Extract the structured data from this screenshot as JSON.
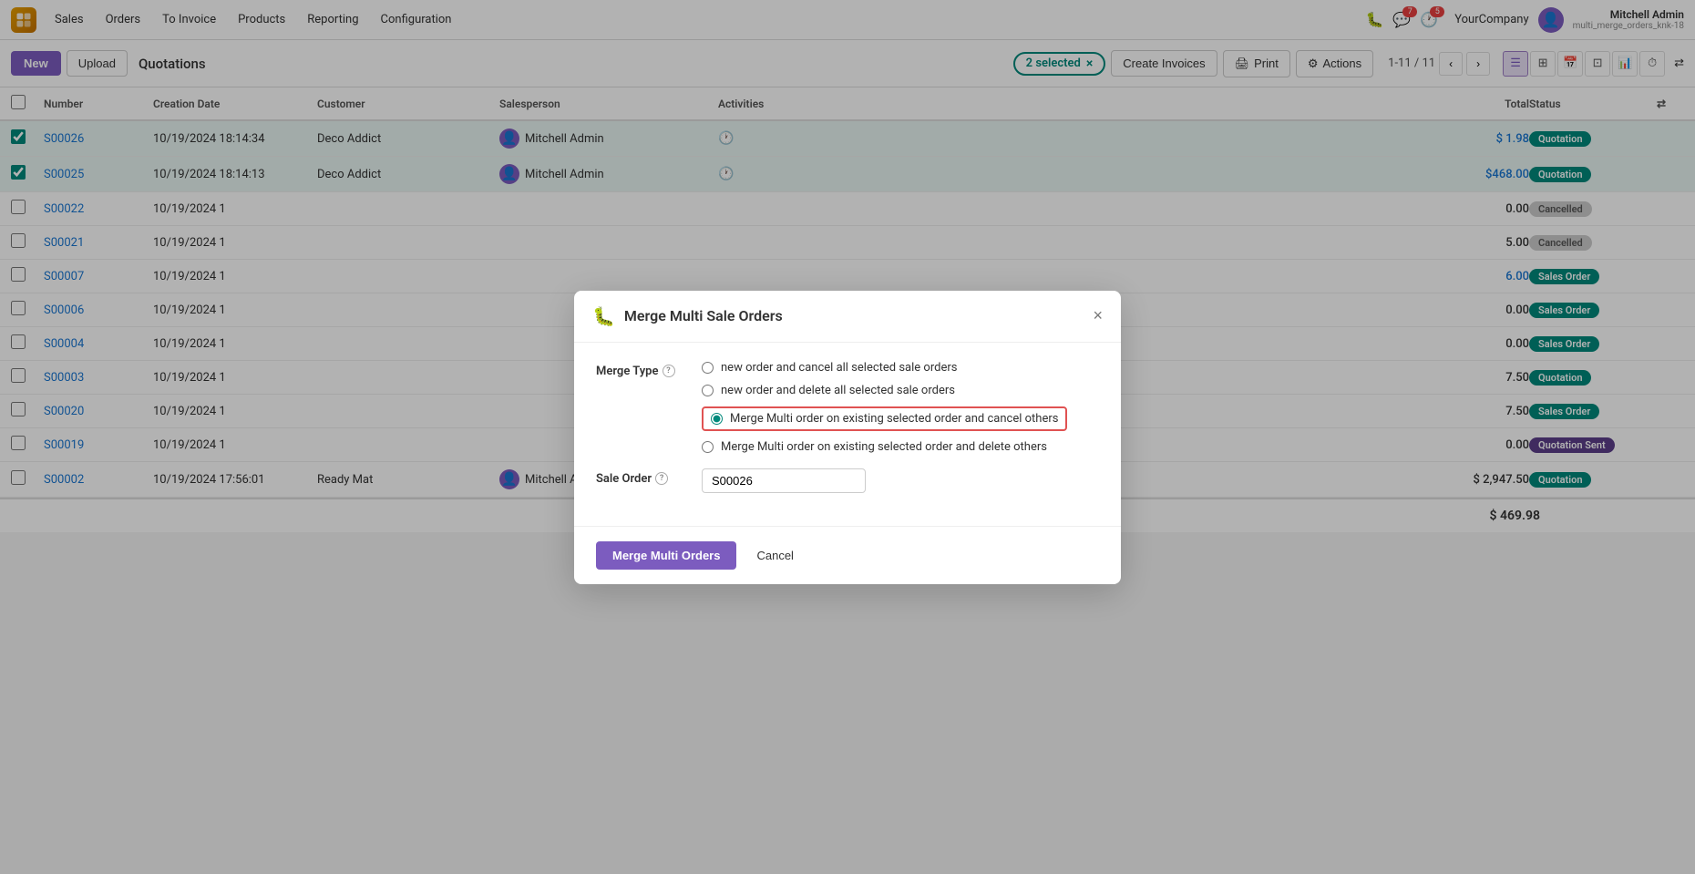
{
  "app": {
    "logo_text": "S",
    "module": "Sales"
  },
  "nav": {
    "items": [
      "Sales",
      "Orders",
      "To Invoice",
      "Products",
      "Reporting",
      "Configuration"
    ],
    "notification_count": "7",
    "message_count": "5",
    "company": "YourCompany",
    "user_name": "Mitchell Admin",
    "user_sub": "multi_merge_orders_knk-18"
  },
  "toolbar": {
    "new_label": "New",
    "upload_label": "Upload",
    "breadcrumb": "Quotations",
    "selected_label": "2 selected",
    "create_invoices_label": "Create Invoices",
    "print_label": "Print",
    "actions_label": "Actions",
    "pagination": "1-11 / 11"
  },
  "table": {
    "headers": [
      "",
      "Number",
      "Creation Date",
      "Customer",
      "Salesperson",
      "Activities",
      "",
      "Total",
      "Status",
      ""
    ],
    "rows": [
      {
        "id": "S00026",
        "date": "10/19/2024 18:14:34",
        "customer": "Deco Addict",
        "salesperson": "Mitchell Admin",
        "has_activity": true,
        "total": "$ 1.98",
        "status": "Quotation",
        "selected": true
      },
      {
        "id": "S00025",
        "date": "10/19/2024 18:14:13",
        "customer": "Deco Addict",
        "salesperson": "Mitchell Admin",
        "has_activity": true,
        "total": "$468.00",
        "status": "Quotation",
        "selected": true
      },
      {
        "id": "S00022",
        "date": "10/19/2024 1",
        "customer": "",
        "salesperson": "",
        "has_activity": false,
        "total": "0.00",
        "status": "Cancelled",
        "selected": false
      },
      {
        "id": "S00021",
        "date": "10/19/2024 1",
        "customer": "",
        "salesperson": "",
        "has_activity": false,
        "total": "5.00",
        "status": "Cancelled",
        "selected": false
      },
      {
        "id": "S00007",
        "date": "10/19/2024 1",
        "customer": "",
        "salesperson": "",
        "has_activity": false,
        "total": "6.00",
        "status": "Sales Order",
        "selected": false
      },
      {
        "id": "S00006",
        "date": "10/19/2024 1",
        "customer": "",
        "salesperson": "",
        "has_activity": false,
        "total": "0.00",
        "status": "Sales Order",
        "selected": false
      },
      {
        "id": "S00004",
        "date": "10/19/2024 1",
        "customer": "",
        "salesperson": "",
        "has_activity": false,
        "total": "0.00",
        "status": "Sales Order",
        "selected": false
      },
      {
        "id": "S00003",
        "date": "10/19/2024 1",
        "customer": "",
        "salesperson": "",
        "has_activity": false,
        "total": "7.50",
        "status": "Quotation",
        "selected": false
      },
      {
        "id": "S00020",
        "date": "10/19/2024 1",
        "customer": "",
        "salesperson": "",
        "has_activity": false,
        "total": "7.50",
        "status": "Sales Order",
        "selected": false
      },
      {
        "id": "S00019",
        "date": "10/19/2024 1",
        "customer": "",
        "salesperson": "",
        "has_activity": false,
        "total": "0.00",
        "status": "Quotation Sent",
        "selected": false
      },
      {
        "id": "S00002",
        "date": "10/19/2024 17:56:01",
        "customer": "Ready Mat",
        "salesperson": "Mitchell Admin",
        "has_activity": true,
        "total": "$ 2,947.50",
        "status": "Quotation",
        "selected": false
      }
    ],
    "summary_total": "$ 469.98"
  },
  "modal": {
    "title": "Merge Multi Sale Orders",
    "close_label": "×",
    "merge_type_label": "Merge Type",
    "help_tooltip": "?",
    "options": [
      {
        "id": "opt1",
        "label": "new order and cancel all selected sale orders",
        "selected": false,
        "highlighted": false
      },
      {
        "id": "opt2",
        "label": "new order and delete all selected sale orders",
        "selected": false,
        "highlighted": false
      },
      {
        "id": "opt3",
        "label": "Merge Multi order on existing selected order and cancel others",
        "selected": true,
        "highlighted": true
      },
      {
        "id": "opt4",
        "label": "Merge Multi order on existing selected order and delete others",
        "selected": false,
        "highlighted": false
      }
    ],
    "sale_order_label": "Sale Order",
    "sale_order_value": "S00026",
    "merge_button": "Merge Multi Orders",
    "cancel_button": "Cancel"
  }
}
